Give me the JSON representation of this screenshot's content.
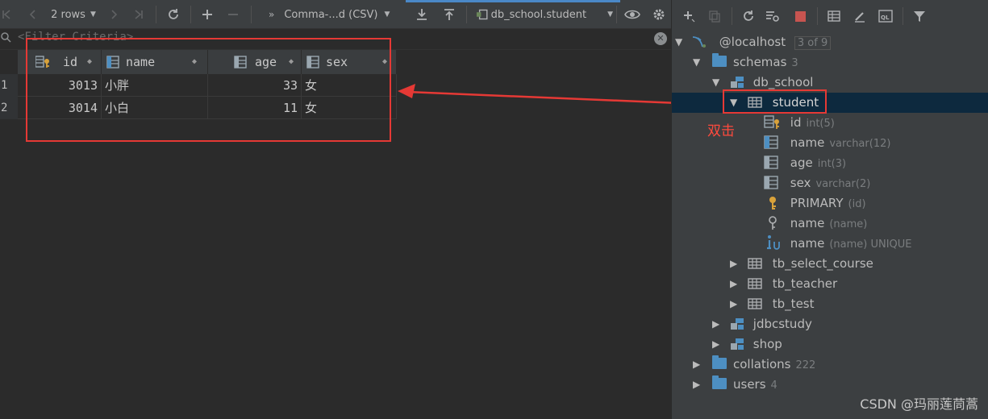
{
  "toolbar": {
    "rows_label": "2 rows",
    "format_label": "Comma-...d (CSV)",
    "table_label": "db_school.student"
  },
  "filter": {
    "placeholder": "<Filter Criteria>"
  },
  "grid": {
    "columns": [
      {
        "name": "id",
        "icon": "primary-key-column-icon"
      },
      {
        "name": "name",
        "icon": "column-icon"
      },
      {
        "name": "age",
        "icon": "column-icon"
      },
      {
        "name": "sex",
        "icon": "column-icon"
      }
    ],
    "rows": [
      {
        "num": "1",
        "id": "3013",
        "name": "小胖",
        "age": "33",
        "sex": "女"
      },
      {
        "num": "2",
        "id": "3014",
        "name": "小白",
        "age": "11",
        "sex": "女"
      }
    ]
  },
  "annotation": {
    "note": "双击",
    "color": "#e53935"
  },
  "tree": {
    "host": {
      "label": "@localhost",
      "badge": "3 of 9"
    },
    "schemas": {
      "label": "schemas",
      "count": "3"
    },
    "db_school": {
      "label": "db_school"
    },
    "student": {
      "label": "student"
    },
    "columns": [
      {
        "label": "id",
        "hint": "int(5)",
        "icon": "primary-key-column-icon"
      },
      {
        "label": "name",
        "hint": "varchar(12)",
        "icon": "column-icon"
      },
      {
        "label": "age",
        "hint": "int(3)",
        "icon": "column-icon"
      },
      {
        "label": "sex",
        "hint": "varchar(2)",
        "icon": "column-icon"
      }
    ],
    "keys": [
      {
        "label": "PRIMARY",
        "hint": "(id)",
        "icon": "key-icon"
      },
      {
        "label": "name",
        "hint": "(name)",
        "icon": "index-icon"
      },
      {
        "label": "name",
        "hint": "(name) UNIQUE",
        "icon": "unique-index-icon"
      }
    ],
    "tables": [
      {
        "label": "tb_select_course"
      },
      {
        "label": "tb_teacher"
      },
      {
        "label": "tb_test"
      }
    ],
    "schemas_other": [
      {
        "label": "jdbcstudy"
      },
      {
        "label": "shop"
      }
    ],
    "collations": {
      "label": "collations",
      "count": "222"
    },
    "users": {
      "label": "users",
      "count": "4"
    }
  },
  "watermark": "CSDN @玛丽莲茼蒿",
  "colors": {
    "accent": "#4a88c7",
    "stop": "#c75450",
    "key": "#d9a23a",
    "folder": "#4d8fc2"
  }
}
